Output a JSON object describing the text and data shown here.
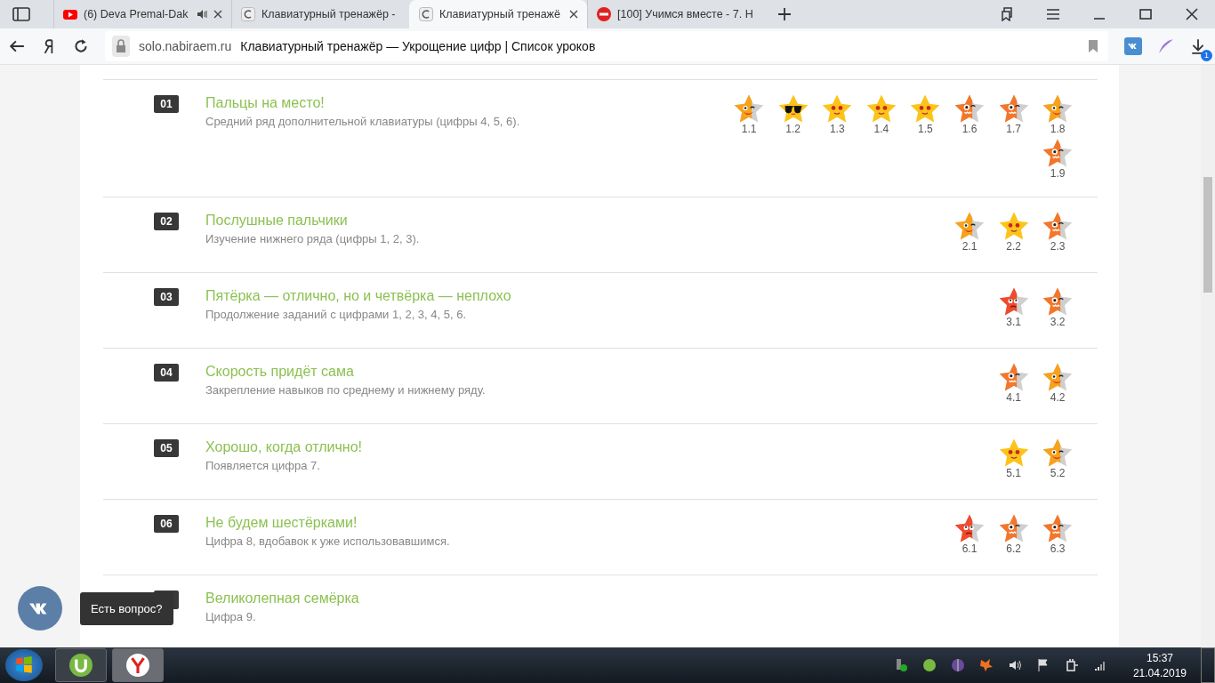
{
  "browser": {
    "tabs": [
      {
        "title": "(6) Deva Premal-Dak",
        "kind": "video",
        "audio": true,
        "closable": true,
        "selected": false
      },
      {
        "title": "Клавиатурный тренажёр -",
        "kind": "site",
        "audio": false,
        "closable": false,
        "selected": false
      },
      {
        "title": "Клавиатурный тренажё",
        "kind": "site",
        "audio": false,
        "closable": true,
        "selected": true
      },
      {
        "title": "[100] Учимся вместе - 7. Н",
        "kind": "blocked",
        "audio": false,
        "closable": false,
        "selected": false
      }
    ],
    "address": {
      "domain": "solo.nabiraem.ru",
      "page_title": "Клавиатурный тренажёр — Укрощение цифр | Список уроков"
    },
    "downloads_badge": "1"
  },
  "lessons": [
    {
      "number": "01",
      "title": "Пальцы на место!",
      "description": "Средний ряд дополнительной клавиатуры (цифры 4, 5, 6).",
      "exercises": [
        {
          "label": "1.1",
          "kind": "wink"
        },
        {
          "label": "1.2",
          "kind": "cool"
        },
        {
          "label": "1.3",
          "kind": "starry"
        },
        {
          "label": "1.4",
          "kind": "starry"
        },
        {
          "label": "1.5",
          "kind": "starry"
        },
        {
          "label": "1.6",
          "kind": "nervous"
        },
        {
          "label": "1.7",
          "kind": "nervous"
        },
        {
          "label": "1.8",
          "kind": "wink"
        },
        {
          "label": "1.9",
          "kind": "nervous"
        }
      ]
    },
    {
      "number": "02",
      "title": "Послушные пальчики",
      "description": "Изучение нижнего ряда (цифры 1, 2, 3).",
      "exercises": [
        {
          "label": "2.1",
          "kind": "wink"
        },
        {
          "label": "2.2",
          "kind": "starry"
        },
        {
          "label": "2.3",
          "kind": "nervous"
        }
      ]
    },
    {
      "number": "03",
      "title": "Пятёрка — отлично, но и четвёрка — неплохо",
      "description": "Продолжение заданий с цифрами 1, 2, 3, 4, 5, 6.",
      "exercises": [
        {
          "label": "3.1",
          "kind": "sad"
        },
        {
          "label": "3.2",
          "kind": "nervous"
        }
      ]
    },
    {
      "number": "04",
      "title": "Скорость придёт сама",
      "description": "Закрепление навыков по среднему и нижнему ряду.",
      "exercises": [
        {
          "label": "4.1",
          "kind": "nervous"
        },
        {
          "label": "4.2",
          "kind": "wink"
        }
      ]
    },
    {
      "number": "05",
      "title": "Хорошо, когда отлично!",
      "description": "Появляется цифра 7.",
      "exercises": [
        {
          "label": "5.1",
          "kind": "starry"
        },
        {
          "label": "5.2",
          "kind": "wink"
        }
      ]
    },
    {
      "number": "06",
      "title": "Не будем шестёрками!",
      "description": "Цифра 8, вдобавок к уже использовавшимся.",
      "exercises": [
        {
          "label": "6.1",
          "kind": "sad"
        },
        {
          "label": "6.2",
          "kind": "nervous"
        },
        {
          "label": "6.3",
          "kind": "nervous"
        }
      ]
    },
    {
      "title": "Великолепная семёрка",
      "description": "Цифра 9."
    }
  ],
  "chat_widget": {
    "tooltip": "Есть вопрос?"
  },
  "taskbar": {
    "time": "15:37",
    "date": "21.04.2019"
  }
}
